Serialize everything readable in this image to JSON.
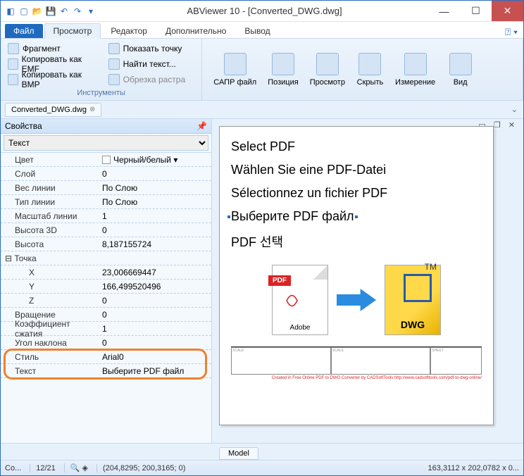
{
  "title": "ABViewer 10 - [Converted_DWG.dwg]",
  "tabs": {
    "file": "Файл",
    "view": "Просмотр",
    "editor": "Редактор",
    "extra": "Дополнительно",
    "output": "Вывод"
  },
  "ribbon": {
    "fragment": "Фрагмент",
    "copy_emf": "Копировать как EMF",
    "copy_bmp": "Копировать как BMP",
    "show_point": "Показать точку",
    "find_text": "Найти текст...",
    "trim_raster": "Обрезка растра",
    "group1": "Инструменты",
    "cad": "САПР файл",
    "pos": "Позиция",
    "preview": "Просмотр",
    "hide": "Скрыть",
    "measure": "Измерение",
    "view": "Вид"
  },
  "doctab": "Converted_DWG.dwg",
  "props_title": "Свойства",
  "type_sel": "Текст",
  "props": [
    {
      "k": "Цвет",
      "v": "Черный/белый",
      "color": true
    },
    {
      "k": "Слой",
      "v": "0"
    },
    {
      "k": "Вес линии",
      "v": "По Слою"
    },
    {
      "k": "Тип линии",
      "v": "По Слою"
    },
    {
      "k": "Масштаб линии",
      "v": "1"
    },
    {
      "k": "Высота 3D",
      "v": "0"
    },
    {
      "k": "Высота",
      "v": "8,187155724"
    }
  ],
  "point_group": "Точка",
  "point": [
    {
      "k": "X",
      "v": "23,006669447"
    },
    {
      "k": "Y",
      "v": "166,499520496"
    },
    {
      "k": "Z",
      "v": "0"
    }
  ],
  "props2": [
    {
      "k": "Вращение",
      "v": "0"
    },
    {
      "k": "Коэффициент сжатия",
      "v": "1"
    },
    {
      "k": "Угол наклона",
      "v": "0"
    }
  ],
  "hl": [
    {
      "k": "Стиль",
      "v": "Arial0"
    },
    {
      "k": "Текст",
      "v": "Выберите PDF файл"
    }
  ],
  "canvas": {
    "lines": [
      "Select PDF",
      "Wählen Sie eine PDF-Datei",
      "Sélectionnez un fichier PDF",
      "Выберите PDF файл",
      "PDF 선택"
    ],
    "pdf": "PDF",
    "adobe": "Adobe",
    "dwg": "DWG",
    "tm": "TM",
    "credit": "Created in Free Online PDF to DWG Converter by CADSoftTools http://www.cadsofttools.com/pdf-to-dwg-online/"
  },
  "model": "Model",
  "status": {
    "cmd": "Co...",
    "count": "12/21",
    "coords": "(204,8295; 200,3165; 0)",
    "size": "163,3112 x 202,0782 x 0..."
  }
}
